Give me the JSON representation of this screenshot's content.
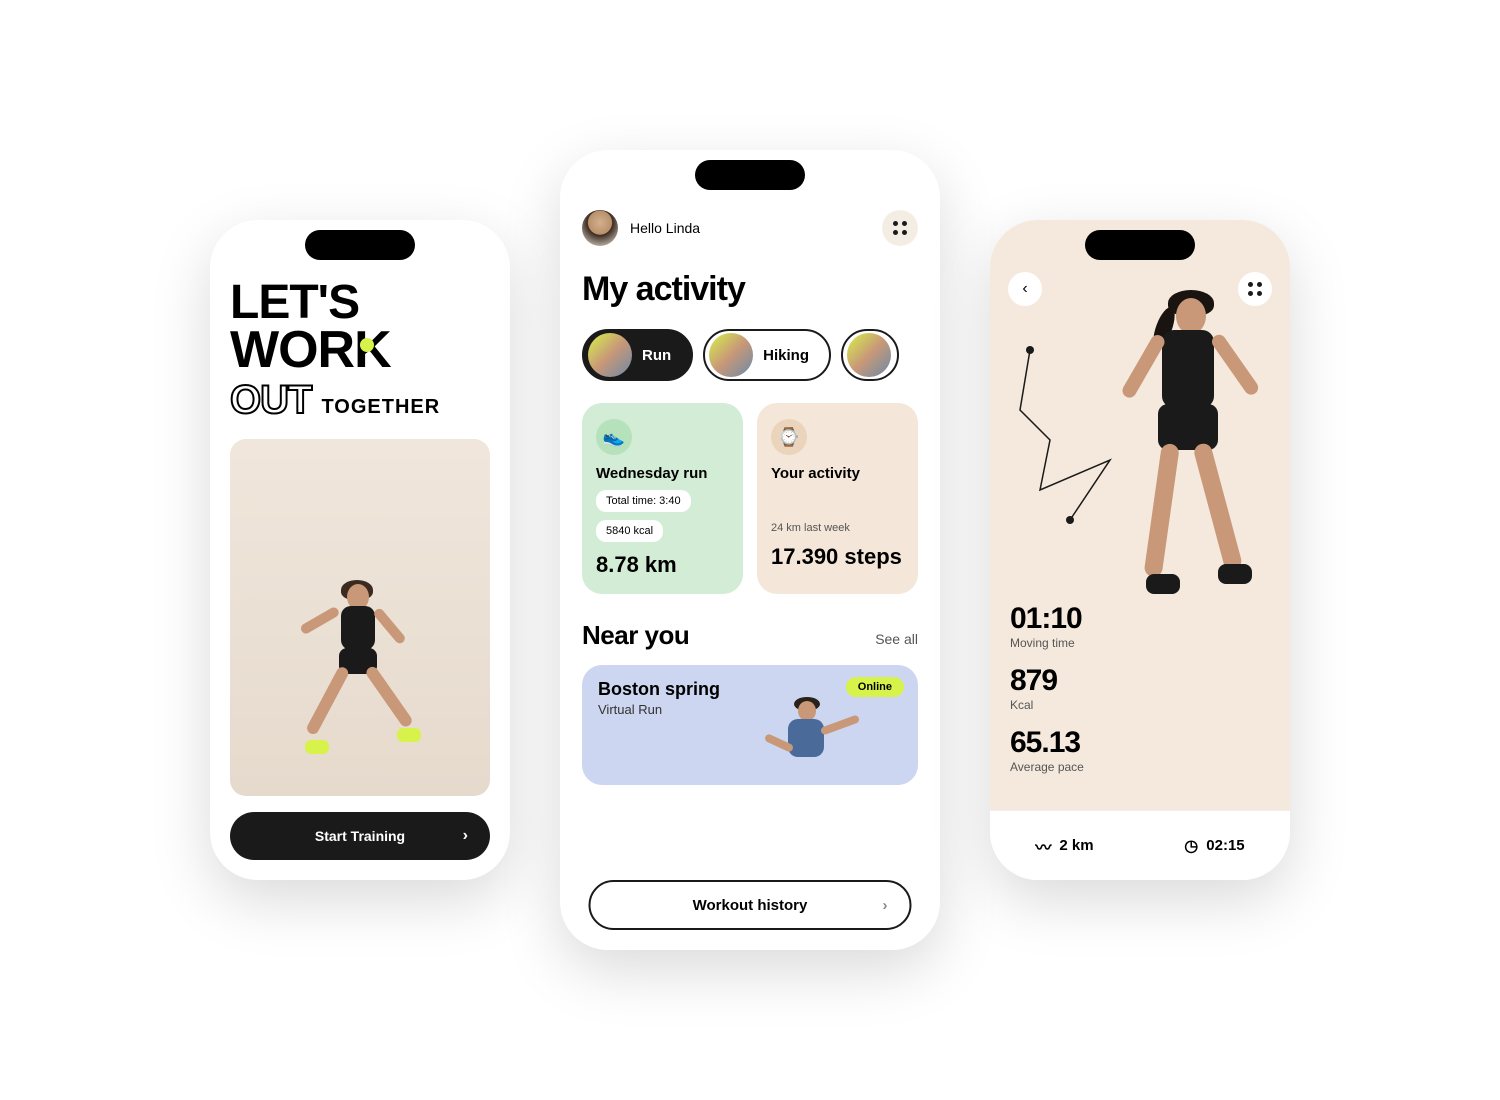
{
  "colors": {
    "accent": "#d7f24a",
    "dark": "#1a1a1a"
  },
  "phone1": {
    "hero_line1": "LET'S",
    "hero_line2": "WORK",
    "hero_line3a": "OUT",
    "hero_line3b": "TOGETHER",
    "cta": "Start Training"
  },
  "phone2": {
    "greeting": "Hello Linda",
    "title": "My activity",
    "chips": [
      {
        "label": "Run",
        "active": true
      },
      {
        "label": "Hiking",
        "active": false
      },
      {
        "label": "",
        "active": false
      }
    ],
    "card_run": {
      "title": "Wednesday run",
      "total_time_label": "Total time: 3:40",
      "kcal_label": "5840 kcal",
      "distance": "8.78 km"
    },
    "card_activity": {
      "title": "Your activity",
      "subtitle": "24 km last week",
      "steps": "17.390 steps"
    },
    "near_title": "Near you",
    "see_all": "See all",
    "event": {
      "title": "Boston spring",
      "subtitle": "Virtual Run",
      "badge": "Online"
    },
    "history_btn": "Workout history"
  },
  "phone3": {
    "stats": [
      {
        "value": "01:10",
        "label": "Moving time"
      },
      {
        "value": "879",
        "label": "Kcal"
      },
      {
        "value": "65.13",
        "label": "Average pace"
      }
    ],
    "footer": {
      "distance": "2 km",
      "time": "02:15"
    }
  }
}
